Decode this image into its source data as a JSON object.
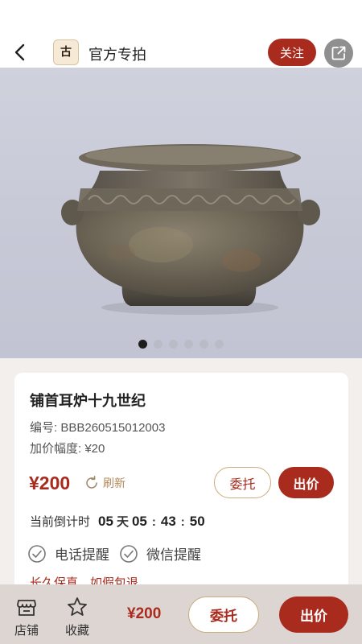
{
  "header": {
    "shop_name": "官方专拍",
    "logo_text": "古",
    "follow_label": "关注"
  },
  "gallery": {
    "image_count": 6,
    "active_index": 0
  },
  "item": {
    "title": "铺首耳炉十九世纪",
    "code": "编号: BBB260515012003",
    "increment": "加价幅度: ¥20",
    "price": "¥200",
    "refresh_label": "刷新",
    "entrust_label": "委托",
    "bid_label": "出价"
  },
  "countdown": {
    "label": "当前倒计时",
    "days": "05",
    "day_unit": "天",
    "hours": "05",
    "minutes": "43",
    "seconds": "50"
  },
  "reminders": {
    "phone_label": "电话提醒",
    "wechat_label": "微信提醒"
  },
  "guarantee": "长久保真，如假包退",
  "bottom_bar": {
    "shop_label": "店铺",
    "favorite_label": "收藏",
    "price": "¥200",
    "entrust_label": "委托",
    "bid_label": "出价"
  },
  "colors": {
    "accent": "#a92b1e",
    "gold": "#c9ab7e"
  }
}
